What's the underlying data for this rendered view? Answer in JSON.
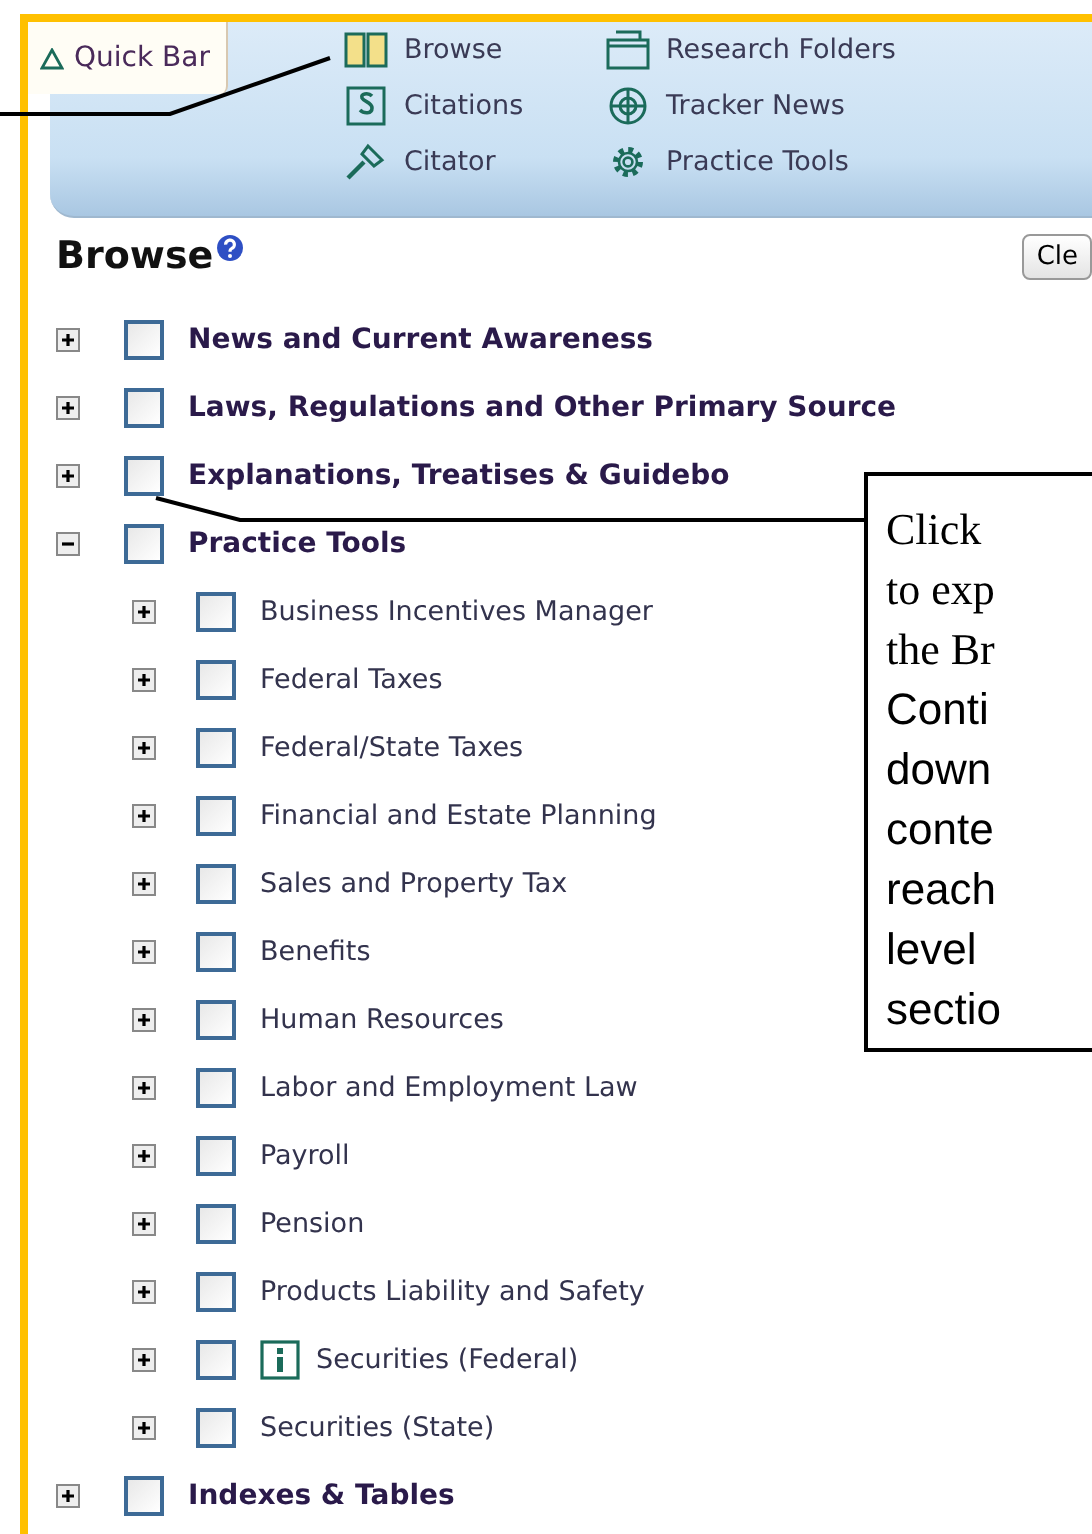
{
  "quick_bar": {
    "tab": "Quick Bar",
    "items": [
      {
        "label": "Browse",
        "kind": "book"
      },
      {
        "label": "Research Folders",
        "kind": "folder"
      },
      {
        "label": "Citations",
        "kind": "section"
      },
      {
        "label": "Tracker News",
        "kind": "target"
      },
      {
        "label": "Citator",
        "kind": "gavel"
      },
      {
        "label": "Practice Tools",
        "kind": "gear"
      }
    ]
  },
  "browse": {
    "title": "Browse",
    "clear_button": "Cle",
    "tree": [
      {
        "label": "News and Current Awareness",
        "expanded": false,
        "checked": false
      },
      {
        "label": "Laws, Regulations and Other Primary Source",
        "expanded": false,
        "checked": false
      },
      {
        "label": "Explanations, Treatises & Guidebo",
        "expanded": false,
        "checked": false
      },
      {
        "label": "Practice Tools",
        "expanded": true,
        "checked": false,
        "children": [
          {
            "label": "Business Incentives Manager",
            "expanded": false,
            "checked": false
          },
          {
            "label": "Federal Taxes",
            "expanded": false,
            "checked": false
          },
          {
            "label": "Federal/State Taxes",
            "expanded": false,
            "checked": false
          },
          {
            "label": "Financial and Estate Planning",
            "expanded": false,
            "checked": false
          },
          {
            "label": "Sales and Property Tax",
            "expanded": false,
            "checked": false
          },
          {
            "label": "Benefits",
            "expanded": false,
            "checked": false
          },
          {
            "label": "Human Resources",
            "expanded": false,
            "checked": false
          },
          {
            "label": "Labor and Employment Law",
            "expanded": false,
            "checked": false
          },
          {
            "label": "Payroll",
            "expanded": false,
            "checked": false
          },
          {
            "label": "Pension",
            "expanded": false,
            "checked": false
          },
          {
            "label": "Products Liability and Safety",
            "expanded": false,
            "checked": false
          },
          {
            "label": "Securities (Federal)",
            "expanded": false,
            "checked": false,
            "info": true
          },
          {
            "label": "Securities (State)",
            "expanded": false,
            "checked": false
          }
        ]
      },
      {
        "label": "Indexes & Tables",
        "expanded": false,
        "checked": false
      }
    ]
  },
  "callout": {
    "lines": [
      "Click",
      "to exp",
      "the Br",
      "Conti",
      "down",
      "conte",
      "reach",
      "level",
      "sectio"
    ]
  }
}
